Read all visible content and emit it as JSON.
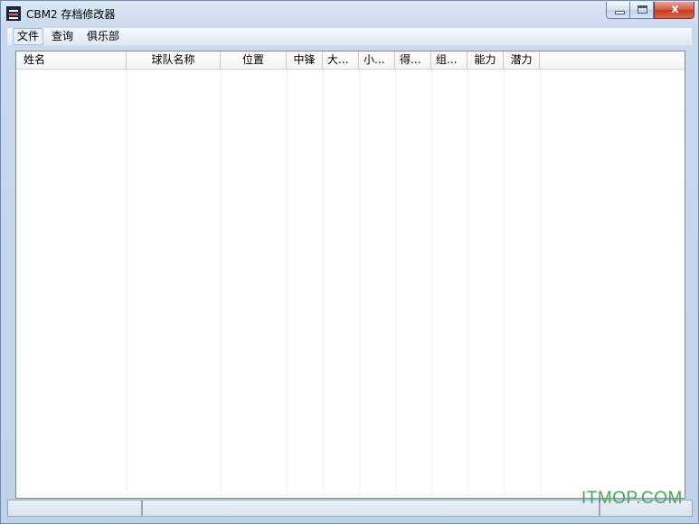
{
  "window": {
    "title": "CBM2 存档修改器",
    "controls": {
      "minimize": "",
      "maximize": "",
      "close": "x"
    }
  },
  "menu": [
    {
      "label": "文件",
      "active": true
    },
    {
      "label": "查询",
      "active": false
    },
    {
      "label": "俱乐部",
      "active": false
    }
  ],
  "table": {
    "columns": [
      "姓名",
      "球队名称",
      "位置",
      "中锋",
      "大...",
      "小...",
      "得...",
      "组...",
      "能力",
      "潜力"
    ],
    "rows": []
  },
  "watermark": "ITMOP.COM"
}
